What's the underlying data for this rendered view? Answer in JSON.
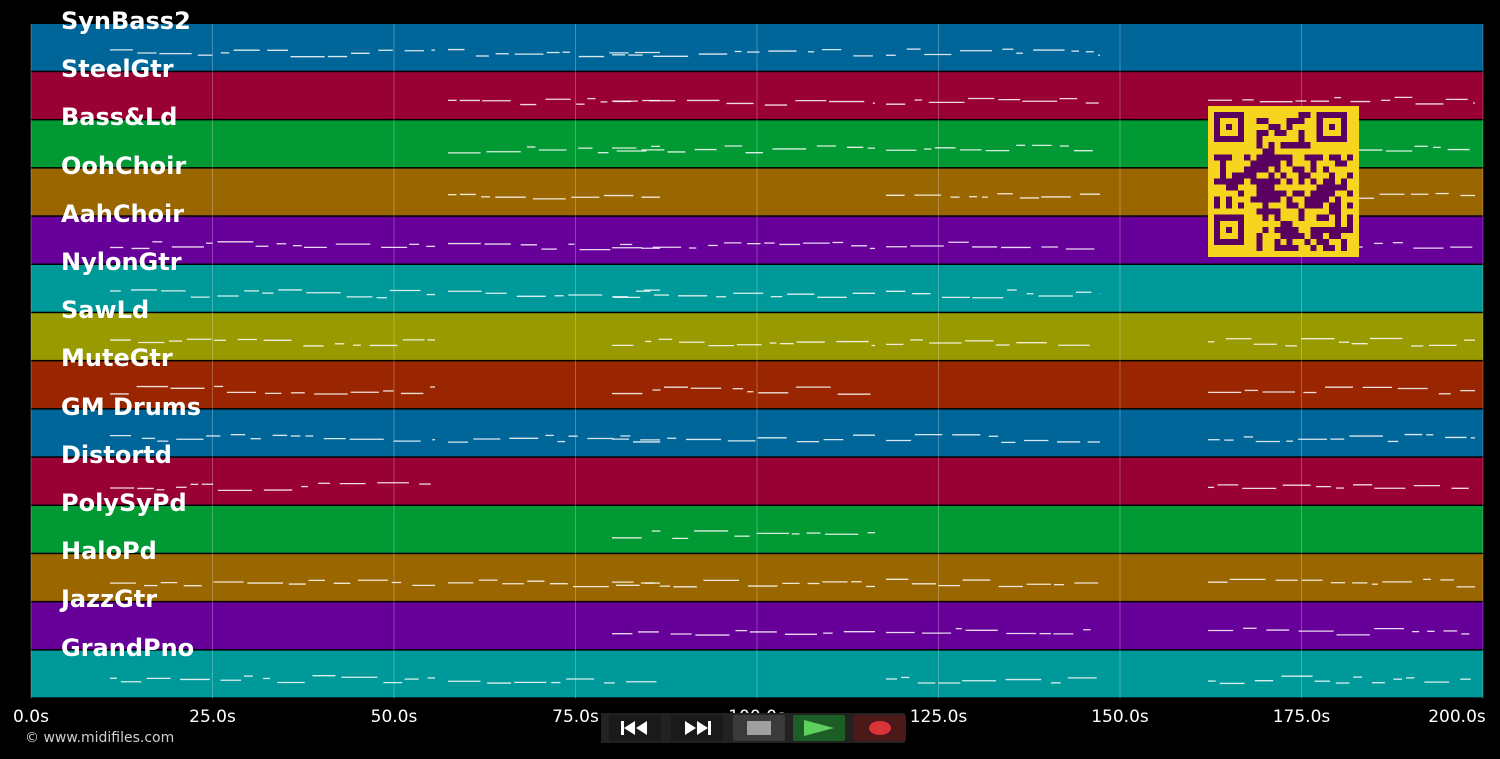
{
  "tracks": [
    {
      "name": "SynBass2",
      "color": "#006699"
    },
    {
      "name": "SteelGtr",
      "color": "#990033"
    },
    {
      "name": "Bass&Ld",
      "color": "#009933"
    },
    {
      "name": "OohChoir",
      "color": "#996600"
    },
    {
      "name": "AahChoir",
      "color": "#660099"
    },
    {
      "name": "NylonGtr",
      "color": "#009999"
    },
    {
      "name": "SawLd",
      "color": "#999900"
    },
    {
      "name": "MuteGtr",
      "color": "#992600"
    },
    {
      "name": "GM Drums",
      "color": "#006699"
    },
    {
      "name": "Distortd",
      "color": "#990033"
    },
    {
      "name": "PolySyPd",
      "color": "#009933"
    },
    {
      "name": "HaloPd",
      "color": "#996600"
    },
    {
      "name": "JazzGtr",
      "color": "#660099"
    },
    {
      "name": "GrandPno",
      "color": "#009999"
    }
  ],
  "timeline": {
    "ticks": [
      "0.0s",
      "25.0s",
      "50.0s",
      "75.0s",
      "100.0s",
      "125.0s",
      "150.0s",
      "175.0s",
      "200.0s"
    ]
  },
  "copyright": "© www.midifiles.com",
  "controls": [
    {
      "id": "rewind",
      "icon": "rewind-icon"
    },
    {
      "id": "fast-forward",
      "icon": "fast-forward-icon"
    },
    {
      "id": "stop",
      "icon": "stop-icon"
    },
    {
      "id": "play",
      "icon": "play-icon"
    },
    {
      "id": "record",
      "icon": "record-icon"
    }
  ],
  "colors": {
    "background": "#000000",
    "note": "#ffffff",
    "qr_fg": "#f6d51f",
    "qr_bg": "#5a0060"
  }
}
